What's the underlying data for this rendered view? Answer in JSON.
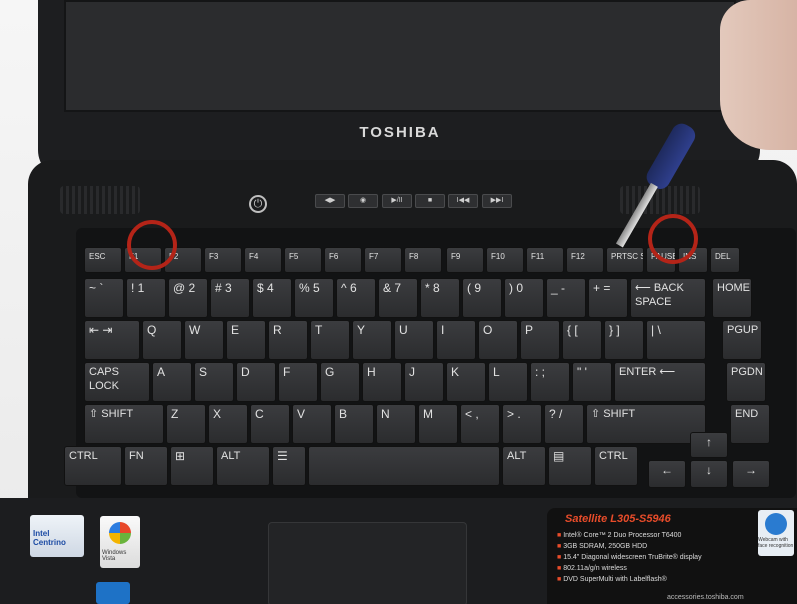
{
  "brand": "TOSHIBA",
  "media_keys": [
    "◀▶",
    "◉",
    "▶/II",
    "■",
    "I◀◀",
    "▶▶I"
  ],
  "function_keys": [
    "ESC",
    "F1",
    "F2",
    "F3",
    "F4",
    "F5",
    "F6",
    "F7",
    "F8",
    "F9",
    "F10",
    "F11",
    "F12",
    "PRTSC SYSRQ",
    "PAUSE BREAK",
    "INS",
    "DEL"
  ],
  "number_row": [
    "~ `",
    "! 1",
    "@ 2",
    "# 3",
    "$ 4",
    "% 5",
    "^ 6",
    "& 7",
    "* 8",
    "( 9",
    ") 0",
    "_ -",
    "+ =",
    "⟵ BACK SPACE"
  ],
  "qwerty_row": [
    "⇤ ⇥",
    "Q",
    "W",
    "E",
    "R",
    "T",
    "Y",
    "U",
    "I",
    "O",
    "P",
    "{ [",
    "} ]",
    "| \\"
  ],
  "home_row": [
    "CAPS LOCK",
    "A",
    "S",
    "D",
    "F",
    "G",
    "H",
    "J",
    "K",
    "L",
    ": ;",
    "\" '",
    "ENTER ⟵"
  ],
  "shift_row": [
    "⇧ SHIFT",
    "Z",
    "X",
    "C",
    "V",
    "B",
    "N",
    "M",
    "< ,",
    "> .",
    "? /",
    "⇧ SHIFT"
  ],
  "bottom_row": [
    "CTRL",
    "FN",
    "⊞",
    "ALT",
    "☰",
    "",
    "ALT",
    "▤",
    "CTRL"
  ],
  "nav_keys": [
    "HOME",
    "PGUP",
    "PGDN",
    "END"
  ],
  "arrow_keys": [
    "↑",
    "←",
    "↓",
    "→"
  ],
  "promo": {
    "title": "Satellite L305-S5946",
    "items": [
      "Intel® Core™ 2 Duo Processor T6400",
      "3GB SDRAM, 250GB HDD",
      "15.4\" Diagonal widescreen TruBrite® display",
      "802.11a/g/n wireless",
      "DVD SuperMulti with Labelflash®"
    ],
    "footer": "accessories.toshiba.com"
  },
  "stickers": {
    "intel": "Intel Centrino",
    "windows": "Windows Vista",
    "webcam": "Webcam with face recognition"
  },
  "colors": {
    "highlight_ring": "#b42418",
    "laptop_body": "#1a1b1c",
    "keycap": "#333436",
    "screwdriver": "#2a3a86"
  }
}
